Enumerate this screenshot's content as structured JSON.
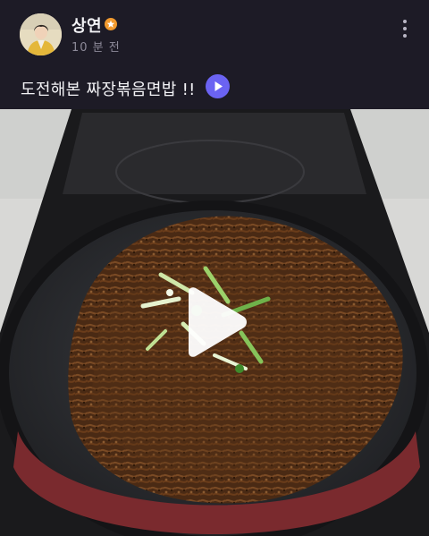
{
  "post": {
    "author": {
      "name": "상연",
      "avatar": "avatar-photo",
      "badge_icon": "star-badge-icon"
    },
    "timestamp": "10 분 전",
    "caption": "도전해본 짜장볶음면밥 !!",
    "caption_play_icon": "play-icon",
    "more_icon": "vertical-dots-icon",
    "media": {
      "type": "video",
      "subject": "jjajang fried noodle rice in a frying pan",
      "play_icon": "play-icon"
    }
  },
  "colors": {
    "background": "#1d1b26",
    "text_primary": "#f2f2f5",
    "text_secondary": "#8d8a99",
    "accent": "#6b63f2",
    "badge": "#f29a2e"
  }
}
